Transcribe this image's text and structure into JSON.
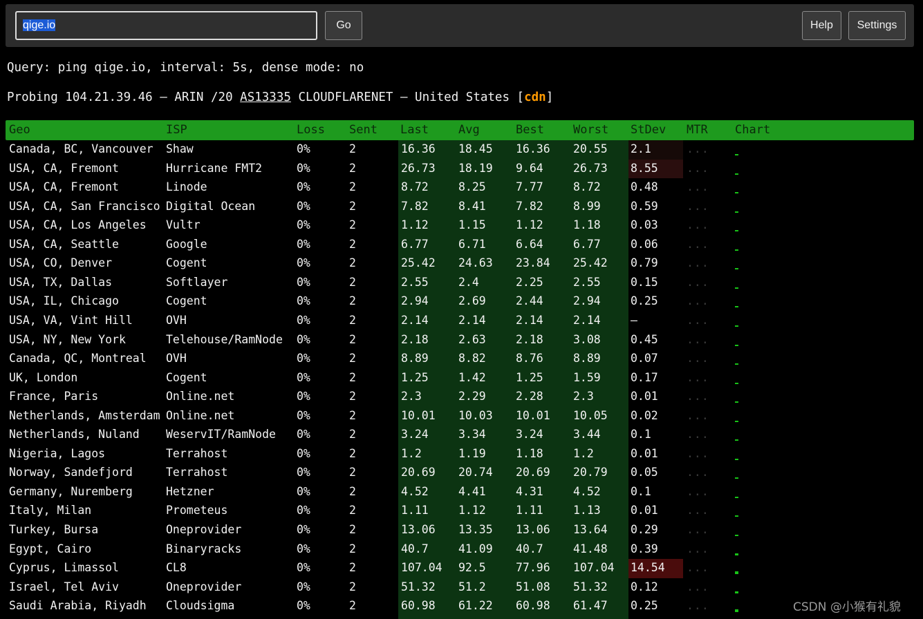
{
  "toolbar": {
    "query_value": "qige.io",
    "go_label": "Go",
    "help_label": "Help",
    "settings_label": "Settings"
  },
  "info": {
    "query_line": "Query: ping qige.io, interval: 5s, dense mode: no",
    "probe_prefix": "Probing 104.21.39.46 — ARIN /20 ",
    "probe_asn": "AS13335",
    "probe_mid": " CLOUDFLARENET — United States [",
    "probe_tag": "cdn",
    "probe_suffix": "]"
  },
  "table": {
    "columns": [
      "Geo",
      "ISP",
      "Loss",
      "Sent",
      "Last",
      "Avg",
      "Best",
      "Worst",
      "StDev",
      "MTR",
      "Chart"
    ],
    "rows": [
      {
        "geo": "Canada, BC, Vancouver",
        "isp": "Shaw",
        "loss": "0%",
        "sent": "2",
        "last": "16.36",
        "avg": "18.45",
        "best": "16.36",
        "worst": "20.55",
        "stdev": "2.1",
        "mtr": "...",
        "stdev_level": 1,
        "chart": 0.29
      },
      {
        "geo": "USA, CA, Fremont",
        "isp": "Hurricane FMT2",
        "loss": "0%",
        "sent": "2",
        "last": "26.73",
        "avg": "18.19",
        "best": "9.64",
        "worst": "26.73",
        "stdev": "8.55",
        "mtr": "...",
        "stdev_level": 2,
        "chart": 0.29
      },
      {
        "geo": "USA, CA, Fremont",
        "isp": "Linode",
        "loss": "0%",
        "sent": "2",
        "last": "8.72",
        "avg": "8.25",
        "best": "7.77",
        "worst": "8.72",
        "stdev": "0.48",
        "mtr": "...",
        "stdev_level": 0,
        "chart": 0.14
      },
      {
        "geo": "USA, CA, San Francisco",
        "isp": "Digital Ocean",
        "loss": "0%",
        "sent": "2",
        "last": "7.82",
        "avg": "8.41",
        "best": "7.82",
        "worst": "8.99",
        "stdev": "0.59",
        "mtr": "...",
        "stdev_level": 0,
        "chart": 0.14
      },
      {
        "geo": "USA, CA, Los Angeles",
        "isp": "Vultr",
        "loss": "0%",
        "sent": "2",
        "last": "1.12",
        "avg": "1.15",
        "best": "1.12",
        "worst": "1.18",
        "stdev": "0.03",
        "mtr": "...",
        "stdev_level": 0,
        "chart": 0.14
      },
      {
        "geo": "USA, CA, Seattle",
        "isp": "Google",
        "loss": "0%",
        "sent": "2",
        "last": "6.77",
        "avg": "6.71",
        "best": "6.64",
        "worst": "6.77",
        "stdev": "0.06",
        "mtr": "...",
        "stdev_level": 0,
        "chart": 0.14
      },
      {
        "geo": "USA, CO, Denver",
        "isp": "Cogent",
        "loss": "0%",
        "sent": "2",
        "last": "25.42",
        "avg": "24.63",
        "best": "23.84",
        "worst": "25.42",
        "stdev": "0.79",
        "mtr": "...",
        "stdev_level": 0,
        "chart": 0.29
      },
      {
        "geo": "USA, TX, Dallas",
        "isp": "Softlayer",
        "loss": "0%",
        "sent": "2",
        "last": "2.55",
        "avg": "2.4",
        "best": "2.25",
        "worst": "2.55",
        "stdev": "0.15",
        "mtr": "...",
        "stdev_level": 0,
        "chart": 0.14
      },
      {
        "geo": "USA, IL, Chicago",
        "isp": "Cogent",
        "loss": "0%",
        "sent": "2",
        "last": "2.94",
        "avg": "2.69",
        "best": "2.44",
        "worst": "2.94",
        "stdev": "0.25",
        "mtr": "...",
        "stdev_level": 0,
        "chart": 0.14
      },
      {
        "geo": "USA, VA, Vint Hill",
        "isp": "OVH",
        "loss": "0%",
        "sent": "2",
        "last": "2.14",
        "avg": "2.14",
        "best": "2.14",
        "worst": "2.14",
        "stdev": "–",
        "mtr": "...",
        "stdev_level": 0,
        "chart": 0.14
      },
      {
        "geo": "USA, NY, New York",
        "isp": "Telehouse/RamNode",
        "loss": "0%",
        "sent": "2",
        "last": "2.18",
        "avg": "2.63",
        "best": "2.18",
        "worst": "3.08",
        "stdev": "0.45",
        "mtr": "...",
        "stdev_level": 0,
        "chart": 0.14
      },
      {
        "geo": "Canada, QC, Montreal",
        "isp": "OVH",
        "loss": "0%",
        "sent": "2",
        "last": "8.89",
        "avg": "8.82",
        "best": "8.76",
        "worst": "8.89",
        "stdev": "0.07",
        "mtr": "...",
        "stdev_level": 0,
        "chart": 0.29
      },
      {
        "geo": "UK, London",
        "isp": "Cogent",
        "loss": "0%",
        "sent": "2",
        "last": "1.25",
        "avg": "1.42",
        "best": "1.25",
        "worst": "1.59",
        "stdev": "0.17",
        "mtr": "...",
        "stdev_level": 0,
        "chart": 0.14
      },
      {
        "geo": "France, Paris",
        "isp": "Online.net",
        "loss": "0%",
        "sent": "2",
        "last": "2.3",
        "avg": "2.29",
        "best": "2.28",
        "worst": "2.3",
        "stdev": "0.01",
        "mtr": "...",
        "stdev_level": 0,
        "chart": 0.14
      },
      {
        "geo": "Netherlands, Amsterdam",
        "isp": "Online.net",
        "loss": "0%",
        "sent": "2",
        "last": "10.01",
        "avg": "10.03",
        "best": "10.01",
        "worst": "10.05",
        "stdev": "0.02",
        "mtr": "...",
        "stdev_level": 0,
        "chart": 0.14
      },
      {
        "geo": "Netherlands, Nuland",
        "isp": "WeservIT/RamNode",
        "loss": "0%",
        "sent": "2",
        "last": "3.24",
        "avg": "3.34",
        "best": "3.24",
        "worst": "3.44",
        "stdev": "0.1",
        "mtr": "...",
        "stdev_level": 0,
        "chart": 0.14
      },
      {
        "geo": "Nigeria, Lagos",
        "isp": "Terrahost",
        "loss": "0%",
        "sent": "2",
        "last": "1.2",
        "avg": "1.19",
        "best": "1.18",
        "worst": "1.2",
        "stdev": "0.01",
        "mtr": "...",
        "stdev_level": 0,
        "chart": 0.14
      },
      {
        "geo": "Norway, Sandefjord",
        "isp": "Terrahost",
        "loss": "0%",
        "sent": "2",
        "last": "20.69",
        "avg": "20.74",
        "best": "20.69",
        "worst": "20.79",
        "stdev": "0.05",
        "mtr": "...",
        "stdev_level": 0,
        "chart": 0.29
      },
      {
        "geo": "Germany, Nuremberg",
        "isp": "Hetzner",
        "loss": "0%",
        "sent": "2",
        "last": "4.52",
        "avg": "4.41",
        "best": "4.31",
        "worst": "4.52",
        "stdev": "0.1",
        "mtr": "...",
        "stdev_level": 0,
        "chart": 0.14
      },
      {
        "geo": "Italy, Milan",
        "isp": "Prometeus",
        "loss": "0%",
        "sent": "2",
        "last": "1.11",
        "avg": "1.12",
        "best": "1.11",
        "worst": "1.13",
        "stdev": "0.01",
        "mtr": "...",
        "stdev_level": 0,
        "chart": 0.14
      },
      {
        "geo": "Turkey, Bursa",
        "isp": "Oneprovider",
        "loss": "0%",
        "sent": "2",
        "last": "13.06",
        "avg": "13.35",
        "best": "13.06",
        "worst": "13.64",
        "stdev": "0.29",
        "mtr": "...",
        "stdev_level": 0,
        "chart": 0.29
      },
      {
        "geo": "Egypt, Cairo",
        "isp": "Binaryracks",
        "loss": "0%",
        "sent": "2",
        "last": "40.7",
        "avg": "41.09",
        "best": "40.7",
        "worst": "41.48",
        "stdev": "0.39",
        "mtr": "...",
        "stdev_level": 0,
        "chart": 0.43
      },
      {
        "geo": "Cyprus, Limassol",
        "isp": "CL8",
        "loss": "0%",
        "sent": "2",
        "last": "107.04",
        "avg": "92.5",
        "best": "77.96",
        "worst": "107.04",
        "stdev": "14.54",
        "mtr": "...",
        "stdev_level": 3,
        "chart": 0.57
      },
      {
        "geo": "Israel, Tel Aviv",
        "isp": "Oneprovider",
        "loss": "0%",
        "sent": "2",
        "last": "51.32",
        "avg": "51.2",
        "best": "51.08",
        "worst": "51.32",
        "stdev": "0.12",
        "mtr": "...",
        "stdev_level": 0,
        "chart": 0.43
      },
      {
        "geo": "Saudi Arabia, Riyadh",
        "isp": "Cloudsigma",
        "loss": "0%",
        "sent": "2",
        "last": "60.98",
        "avg": "61.22",
        "best": "60.98",
        "worst": "61.47",
        "stdev": "0.25",
        "mtr": "...",
        "stdev_level": 0,
        "chart": 0.57
      }
    ]
  },
  "colors": {
    "header_bg": "#1e9a1e",
    "latency_band": "#0c3412",
    "chart_bar": "#18c418",
    "cdn_tag": "#ff9a00",
    "stdev_levels": [
      "transparent",
      "#160a08",
      "#2a0e0e",
      "#4a0c0c"
    ]
  },
  "watermark": "CSDN @小猴有礼貌"
}
